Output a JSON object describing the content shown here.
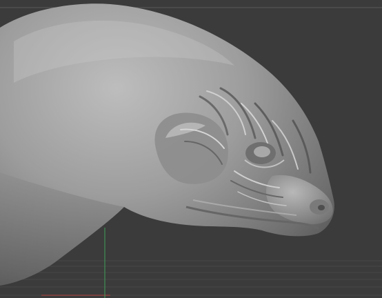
{
  "viewport": {
    "background_color": "#3b3b3b",
    "top_line_color": "#5a5a5a",
    "floor_grid_color": "#4a4a4a",
    "axis_x_color": "#b3443f",
    "axis_y_color": "#3fa05a",
    "model_color": "#9a9a9a",
    "model_highlight_color": "#c4c4c4",
    "model_shadow_color": "#5e5e5e",
    "subject": "sculpted-creature-head"
  }
}
